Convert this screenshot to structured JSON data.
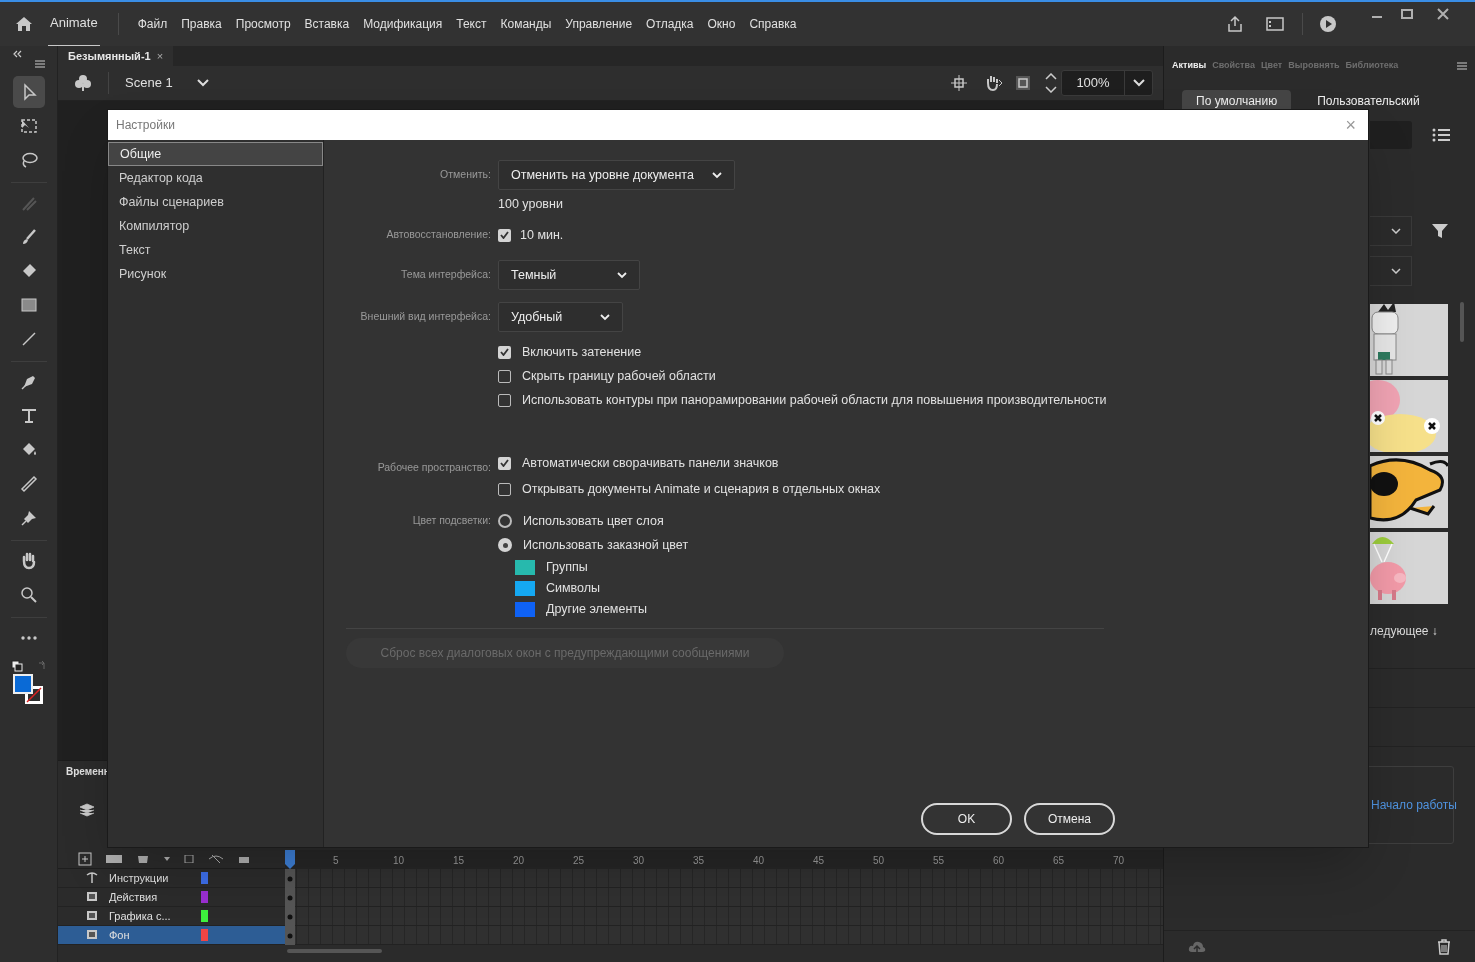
{
  "app": {
    "name": "Animate"
  },
  "menu": [
    "Файл",
    "Правка",
    "Просмотр",
    "Вставка",
    "Модификация",
    "Текст",
    "Команды",
    "Управление",
    "Отладка",
    "Окно",
    "Справка"
  ],
  "document_tab": {
    "title": "Безымянный-1",
    "close": "×"
  },
  "scene": {
    "name": "Scene 1",
    "zoom": "100%"
  },
  "tools": [
    {
      "kind": "select",
      "selected": true
    },
    {
      "kind": "transform",
      "selected": false
    },
    {
      "kind": "lasso",
      "selected": false
    },
    {
      "kind": "fluid",
      "selected": false
    },
    {
      "kind": "brush",
      "selected": false
    },
    {
      "kind": "eraser",
      "selected": false
    },
    {
      "kind": "rectangle",
      "selected": false
    },
    {
      "kind": "line",
      "selected": false
    },
    {
      "kind": "pen",
      "selected": false
    },
    {
      "kind": "text",
      "selected": false
    },
    {
      "kind": "bucket",
      "selected": false
    },
    {
      "kind": "eyedropper",
      "selected": false
    },
    {
      "kind": "pin",
      "selected": false
    },
    {
      "kind": "hand",
      "selected": false
    },
    {
      "kind": "zoom",
      "selected": false
    },
    {
      "kind": "more",
      "selected": false
    }
  ],
  "right_panel": {
    "tabs": [
      {
        "label": "Активы",
        "selected": true
      },
      {
        "label": "Свойства",
        "selected": false
      },
      {
        "label": "Цвет",
        "selected": false
      },
      {
        "label": "Выровнять",
        "selected": false
      },
      {
        "label": "Библиотека",
        "selected": false
      }
    ],
    "subtabs": [
      {
        "label": "По умолчанию",
        "selected": true
      },
      {
        "label": "Пользовательский",
        "selected": false
      }
    ],
    "next": "ледующее ↓",
    "link": "Начало работы"
  },
  "timeline": {
    "title": "Временн",
    "frame_numbers": [
      "5",
      "10",
      "15",
      "20",
      "25",
      "30",
      "35",
      "40",
      "45",
      "50",
      "55",
      "60",
      "65",
      "70"
    ],
    "layers": [
      {
        "name": "Инструкции",
        "kind": "guide",
        "color": "#3d6ee8",
        "selected": false
      },
      {
        "name": "Действия",
        "kind": "normal",
        "color": "#9b2fd2",
        "selected": false
      },
      {
        "name": "Графика с...",
        "kind": "normal",
        "color": "#3ef03e",
        "selected": false
      },
      {
        "name": "Фон",
        "kind": "normal",
        "color": "#f04545",
        "selected": true
      }
    ]
  },
  "dialog": {
    "title": "Настройки",
    "close": "×",
    "categories": [
      {
        "label": "Общие",
        "selected": true
      },
      {
        "label": "Редактор кода",
        "selected": false
      },
      {
        "label": "Файлы сценариев",
        "selected": false
      },
      {
        "label": "Компилятор",
        "selected": false
      },
      {
        "label": "Текст",
        "selected": false
      },
      {
        "label": "Рисунок",
        "selected": false
      }
    ],
    "undo": {
      "label": "Отменить:",
      "value": "Отменить на уровне документа",
      "levels": "100 уровни"
    },
    "autosave": {
      "label": "Автовосстановление:",
      "checked": true,
      "value": "10 мин."
    },
    "theme": {
      "label": "Тема интерфейса:",
      "value": "Темный"
    },
    "appearance": {
      "label": "Внешний вид интерфейса:",
      "value": "Удобный"
    },
    "ui_options": [
      {
        "label": "Включить затенение",
        "checked": true
      },
      {
        "label": "Скрыть границу рабочей области",
        "checked": false
      },
      {
        "label": "Использовать контуры при панорамировании рабочей области для повышения производительности",
        "checked": false
      }
    ],
    "workspace": {
      "label": "Рабочее пространство:",
      "options": [
        {
          "label": "Автоматически сворачивать панели значков",
          "checked": true
        },
        {
          "label": "Открывать документы Animate и сценария в отдельных окнах",
          "checked": false
        }
      ]
    },
    "highlight": {
      "label": "Цвет подсветки:",
      "options": [
        {
          "label": "Использовать цвет слоя",
          "selected": false
        },
        {
          "label": "Использовать заказной цвет",
          "selected": true
        }
      ],
      "swatches": [
        {
          "label": "Группы",
          "color": "#27b9ad"
        },
        {
          "label": "Символы",
          "color": "#15a8f2"
        },
        {
          "label": "Другие элементы",
          "color": "#0f62f5"
        }
      ]
    },
    "reset_button": {
      "label": "Сброс всех диалоговых окон с предупреждающими сообщениями",
      "disabled": true
    },
    "buttons": [
      "OK",
      "Отмена"
    ]
  }
}
